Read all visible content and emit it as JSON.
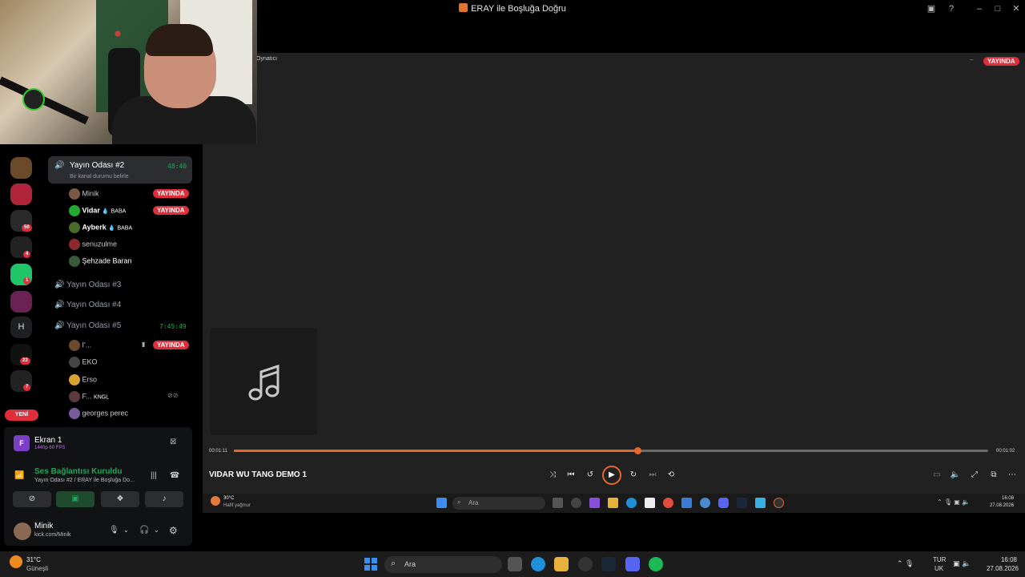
{
  "window": {
    "title": "ERAY ile Boşluğa Doğru"
  },
  "player": {
    "label": "Oynatıcı",
    "live_badge": "YAYINDA",
    "track_title": "VIDAR WU TANG DEMO 1",
    "time_current": "00:01:11",
    "time_total": "00:01:02",
    "progress": 0.535
  },
  "inner_taskbar": {
    "weather_temp": "30°C",
    "weather_desc": "Hafif yağmur",
    "search": "Ara",
    "time": "16:08",
    "date": "27.08.2026"
  },
  "servers": [
    {
      "badge": ""
    },
    {
      "badge": ""
    },
    {
      "badge": "50"
    },
    {
      "badge": "4"
    },
    {
      "badge": "1"
    },
    {
      "badge": ""
    },
    {
      "letter": "H",
      "badge": ""
    },
    {
      "badge": "23"
    },
    {
      "badge": "7"
    }
  ],
  "new_label": "YENİ",
  "channels": {
    "room2": {
      "name": "Yayın Odası #2",
      "timer": "48:40",
      "status": "Bir kanal durumu belirle"
    },
    "room2_members": [
      {
        "name": "Minik",
        "live": "YAYINDA"
      },
      {
        "name": "Vidar",
        "tag": "BABA",
        "live": "YAYINDA"
      },
      {
        "name": "Ayberk",
        "tag": "BABA"
      },
      {
        "name": "senuzulme"
      },
      {
        "name": "Şehzade Baran"
      }
    ],
    "room3": {
      "name": "Yayın Odası #3"
    },
    "room4": {
      "name": "Yayın Odası #4"
    },
    "room5": {
      "name": "Yayın Odası #5",
      "timer": "7:45:49"
    },
    "room5_members": [
      {
        "name": "I'...",
        "live": "YAYINDA"
      },
      {
        "name": "EKO"
      },
      {
        "name": "Erso"
      },
      {
        "name": "F...",
        "tag": "KNGL"
      },
      {
        "name": "georges perec"
      }
    ]
  },
  "stream": {
    "name": "Ekran 1",
    "quality": "1440p 60 FPS"
  },
  "voice": {
    "status": "Ses Bağlantısı Kuruldu",
    "location": "Yayın Odası #2 / ERAY ile Boşluğa Do..."
  },
  "user": {
    "name": "Minik",
    "status": "kick.com/Minik"
  },
  "taskbar": {
    "weather_temp": "31°C",
    "weather_desc": "Güneşli",
    "search": "Ara",
    "lang": "TUR",
    "region": "UK",
    "time": "16:08",
    "date": "27.08.2026"
  }
}
